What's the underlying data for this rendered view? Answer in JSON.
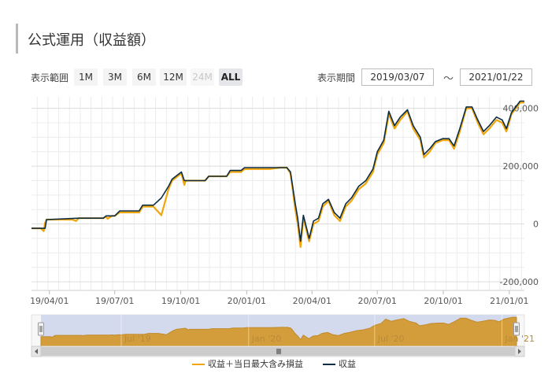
{
  "header": {
    "title": "公式運用（収益額）"
  },
  "range_selector": {
    "label": "表示範囲",
    "buttons": [
      {
        "label": "1M",
        "state": "normal"
      },
      {
        "label": "3M",
        "state": "normal"
      },
      {
        "label": "6M",
        "state": "normal"
      },
      {
        "label": "12M",
        "state": "normal"
      },
      {
        "label": "24M",
        "state": "disabled"
      },
      {
        "label": "ALL",
        "state": "active"
      }
    ]
  },
  "period": {
    "label": "表示期間",
    "start": "2019/03/07",
    "separator": "～",
    "end": "2021/01/22"
  },
  "colors": {
    "primary_line": "#0d2d44",
    "secondary_line": "#f0a60a",
    "navigator_fill": "#d49d3c",
    "navigator_bg": "#d4daee"
  },
  "chart_data": {
    "type": "line",
    "y_ticks": [
      "-200,000",
      "0",
      "200,000",
      "400,000"
    ],
    "ylim": [
      -230000,
      440000
    ],
    "x_ticks": [
      {
        "label": "19/04/01",
        "x": "2019-04-01"
      },
      {
        "label": "19/07/01",
        "x": "2019-07-01"
      },
      {
        "label": "19/10/01",
        "x": "2019-10-01"
      },
      {
        "label": "20/01/01",
        "x": "2020-01-01"
      },
      {
        "label": "20/04/01",
        "x": "2020-04-01"
      },
      {
        "label": "20/07/01",
        "x": "2020-07-01"
      },
      {
        "label": "20/10/01",
        "x": "2020-10-01"
      },
      {
        "label": "21/01/01",
        "x": "2021-01-01"
      }
    ],
    "xlim": [
      "2019-03-07",
      "2021-01-22"
    ],
    "grid": true,
    "legend_position": "bottom-center",
    "series": [
      {
        "name": "収益＋当日最大含み損益",
        "color": "#f0a60a",
        "points": [
          [
            "2019-03-07",
            -15000
          ],
          [
            "2019-03-20",
            -15000
          ],
          [
            "2019-03-24",
            -25000
          ],
          [
            "2019-03-26",
            5000
          ],
          [
            "2019-03-28",
            15000
          ],
          [
            "2019-05-03",
            15000
          ],
          [
            "2019-05-08",
            10000
          ],
          [
            "2019-05-12",
            20000
          ],
          [
            "2019-06-15",
            20000
          ],
          [
            "2019-06-19",
            25000
          ],
          [
            "2019-06-21",
            18000
          ],
          [
            "2019-06-27",
            28000
          ],
          [
            "2019-07-01",
            28000
          ],
          [
            "2019-07-08",
            40000
          ],
          [
            "2019-08-04",
            40000
          ],
          [
            "2019-08-09",
            60000
          ],
          [
            "2019-08-24",
            60000
          ],
          [
            "2019-09-04",
            30000
          ],
          [
            "2019-09-14",
            120000
          ],
          [
            "2019-09-19",
            150000
          ],
          [
            "2019-10-02",
            175000
          ],
          [
            "2019-10-06",
            135000
          ],
          [
            "2019-10-08",
            150000
          ],
          [
            "2019-11-04",
            150000
          ],
          [
            "2019-11-09",
            165000
          ],
          [
            "2019-12-04",
            165000
          ],
          [
            "2019-12-09",
            180000
          ],
          [
            "2019-12-24",
            180000
          ],
          [
            "2019-12-29",
            190000
          ],
          [
            "2020-02-02",
            190000
          ],
          [
            "2020-02-16",
            195000
          ],
          [
            "2020-02-26",
            195000
          ],
          [
            "2020-03-02",
            175000
          ],
          [
            "2020-03-05",
            120000
          ],
          [
            "2020-03-08",
            60000
          ],
          [
            "2020-03-12",
            0
          ],
          [
            "2020-03-16",
            -80000
          ],
          [
            "2020-03-20",
            20000
          ],
          [
            "2020-03-24",
            -20000
          ],
          [
            "2020-03-28",
            -60000
          ],
          [
            "2020-04-03",
            0
          ],
          [
            "2020-04-10",
            10000
          ],
          [
            "2020-04-16",
            60000
          ],
          [
            "2020-04-24",
            80000
          ],
          [
            "2020-05-02",
            30000
          ],
          [
            "2020-05-10",
            10000
          ],
          [
            "2020-05-18",
            60000
          ],
          [
            "2020-05-26",
            80000
          ],
          [
            "2020-06-05",
            120000
          ],
          [
            "2020-06-15",
            140000
          ],
          [
            "2020-06-25",
            180000
          ],
          [
            "2020-07-01",
            240000
          ],
          [
            "2020-07-10",
            280000
          ],
          [
            "2020-07-17",
            380000
          ],
          [
            "2020-07-25",
            330000
          ],
          [
            "2020-08-02",
            360000
          ],
          [
            "2020-08-12",
            390000
          ],
          [
            "2020-08-20",
            330000
          ],
          [
            "2020-08-30",
            290000
          ],
          [
            "2020-09-04",
            230000
          ],
          [
            "2020-09-12",
            250000
          ],
          [
            "2020-09-20",
            280000
          ],
          [
            "2020-09-30",
            290000
          ],
          [
            "2020-10-09",
            290000
          ],
          [
            "2020-10-16",
            260000
          ],
          [
            "2020-10-24",
            320000
          ],
          [
            "2020-11-02",
            400000
          ],
          [
            "2020-11-10",
            400000
          ],
          [
            "2020-11-18",
            350000
          ],
          [
            "2020-11-26",
            310000
          ],
          [
            "2020-12-04",
            330000
          ],
          [
            "2020-12-14",
            360000
          ],
          [
            "2020-12-22",
            350000
          ],
          [
            "2020-12-28",
            320000
          ],
          [
            "2021-01-04",
            380000
          ],
          [
            "2021-01-10",
            400000
          ],
          [
            "2021-01-16",
            420000
          ],
          [
            "2021-01-22",
            420000
          ]
        ]
      },
      {
        "name": "収益",
        "color": "#0d2d44",
        "points": [
          [
            "2019-03-07",
            -15000
          ],
          [
            "2019-03-26",
            -15000
          ],
          [
            "2019-03-28",
            15000
          ],
          [
            "2019-05-12",
            20000
          ],
          [
            "2019-06-15",
            20000
          ],
          [
            "2019-06-19",
            28000
          ],
          [
            "2019-07-01",
            28000
          ],
          [
            "2019-07-08",
            45000
          ],
          [
            "2019-08-04",
            45000
          ],
          [
            "2019-08-09",
            65000
          ],
          [
            "2019-08-24",
            65000
          ],
          [
            "2019-09-04",
            90000
          ],
          [
            "2019-09-14",
            130000
          ],
          [
            "2019-09-19",
            155000
          ],
          [
            "2019-10-02",
            180000
          ],
          [
            "2019-10-06",
            150000
          ],
          [
            "2019-11-04",
            150000
          ],
          [
            "2019-11-09",
            165000
          ],
          [
            "2019-12-04",
            165000
          ],
          [
            "2019-12-09",
            185000
          ],
          [
            "2019-12-24",
            185000
          ],
          [
            "2019-12-29",
            195000
          ],
          [
            "2020-02-26",
            195000
          ],
          [
            "2020-03-02",
            180000
          ],
          [
            "2020-03-05",
            130000
          ],
          [
            "2020-03-08",
            80000
          ],
          [
            "2020-03-12",
            20000
          ],
          [
            "2020-03-16",
            -60000
          ],
          [
            "2020-03-20",
            30000
          ],
          [
            "2020-03-24",
            -10000
          ],
          [
            "2020-03-28",
            -50000
          ],
          [
            "2020-04-03",
            10000
          ],
          [
            "2020-04-10",
            20000
          ],
          [
            "2020-04-16",
            70000
          ],
          [
            "2020-04-24",
            85000
          ],
          [
            "2020-05-02",
            40000
          ],
          [
            "2020-05-10",
            20000
          ],
          [
            "2020-05-18",
            70000
          ],
          [
            "2020-05-26",
            90000
          ],
          [
            "2020-06-05",
            130000
          ],
          [
            "2020-06-15",
            150000
          ],
          [
            "2020-06-25",
            190000
          ],
          [
            "2020-07-01",
            250000
          ],
          [
            "2020-07-10",
            290000
          ],
          [
            "2020-07-17",
            390000
          ],
          [
            "2020-07-25",
            340000
          ],
          [
            "2020-08-02",
            370000
          ],
          [
            "2020-08-12",
            395000
          ],
          [
            "2020-08-20",
            340000
          ],
          [
            "2020-08-30",
            300000
          ],
          [
            "2020-09-04",
            240000
          ],
          [
            "2020-09-12",
            260000
          ],
          [
            "2020-09-20",
            285000
          ],
          [
            "2020-09-30",
            295000
          ],
          [
            "2020-10-09",
            295000
          ],
          [
            "2020-10-16",
            270000
          ],
          [
            "2020-10-24",
            330000
          ],
          [
            "2020-11-02",
            405000
          ],
          [
            "2020-11-10",
            405000
          ],
          [
            "2020-11-18",
            360000
          ],
          [
            "2020-11-26",
            320000
          ],
          [
            "2020-12-04",
            340000
          ],
          [
            "2020-12-14",
            370000
          ],
          [
            "2020-12-22",
            360000
          ],
          [
            "2020-12-28",
            330000
          ],
          [
            "2021-01-04",
            385000
          ],
          [
            "2021-01-10",
            405000
          ],
          [
            "2021-01-16",
            425000
          ],
          [
            "2021-01-22",
            425000
          ]
        ]
      }
    ],
    "navigator": {
      "ticks": [
        {
          "label": "Jul '19",
          "x": "2019-07-01"
        },
        {
          "label": "Jan '20",
          "x": "2020-01-01"
        },
        {
          "label": "Jul '20",
          "x": "2020-07-01"
        },
        {
          "label": "Jan '21",
          "x": "2021-01-01"
        }
      ],
      "handle_icon": "grip-icon"
    }
  }
}
